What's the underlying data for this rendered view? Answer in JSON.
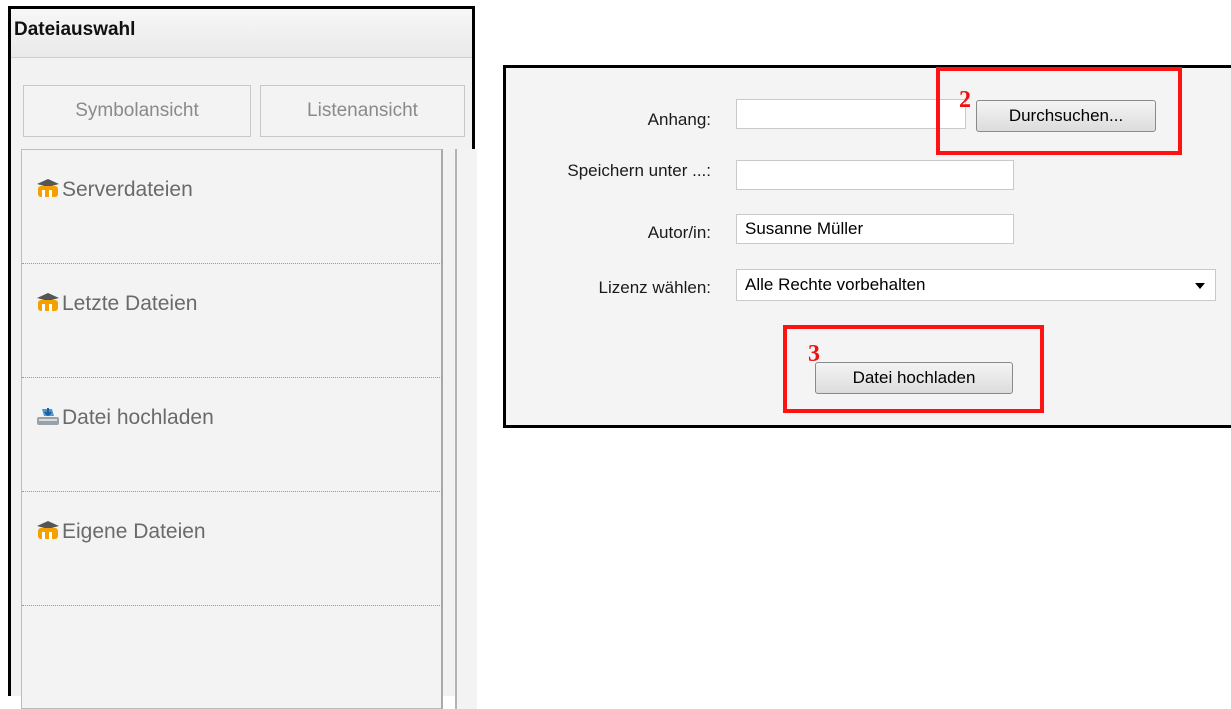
{
  "picker": {
    "title": "Dateiauswahl",
    "view_buttons": {
      "symbol": "Symbolansicht",
      "list": "Listenansicht"
    },
    "repositories": [
      {
        "label": "Serverdateien",
        "icon": "moodle-icon"
      },
      {
        "label": "Letzte Dateien",
        "icon": "moodle-icon"
      },
      {
        "label": "Datei hochladen",
        "icon": "upload-icon"
      },
      {
        "label": "Eigene Dateien",
        "icon": "moodle-icon"
      }
    ]
  },
  "form": {
    "attachment_label": "Anhang:",
    "attachment_value": "",
    "browse_label": "Durchsuchen...",
    "save_as_label": "Speichern unter ...:",
    "save_as_value": "",
    "author_label": "Autor/in:",
    "author_value": "Susanne Müller",
    "license_label": "Lizenz wählen:",
    "license_value": "Alle Rechte vorbehalten",
    "upload_button": "Datei hochladen"
  },
  "annotations": {
    "step2": "2",
    "step3": "3",
    "highlight_color": "#ff1212"
  }
}
